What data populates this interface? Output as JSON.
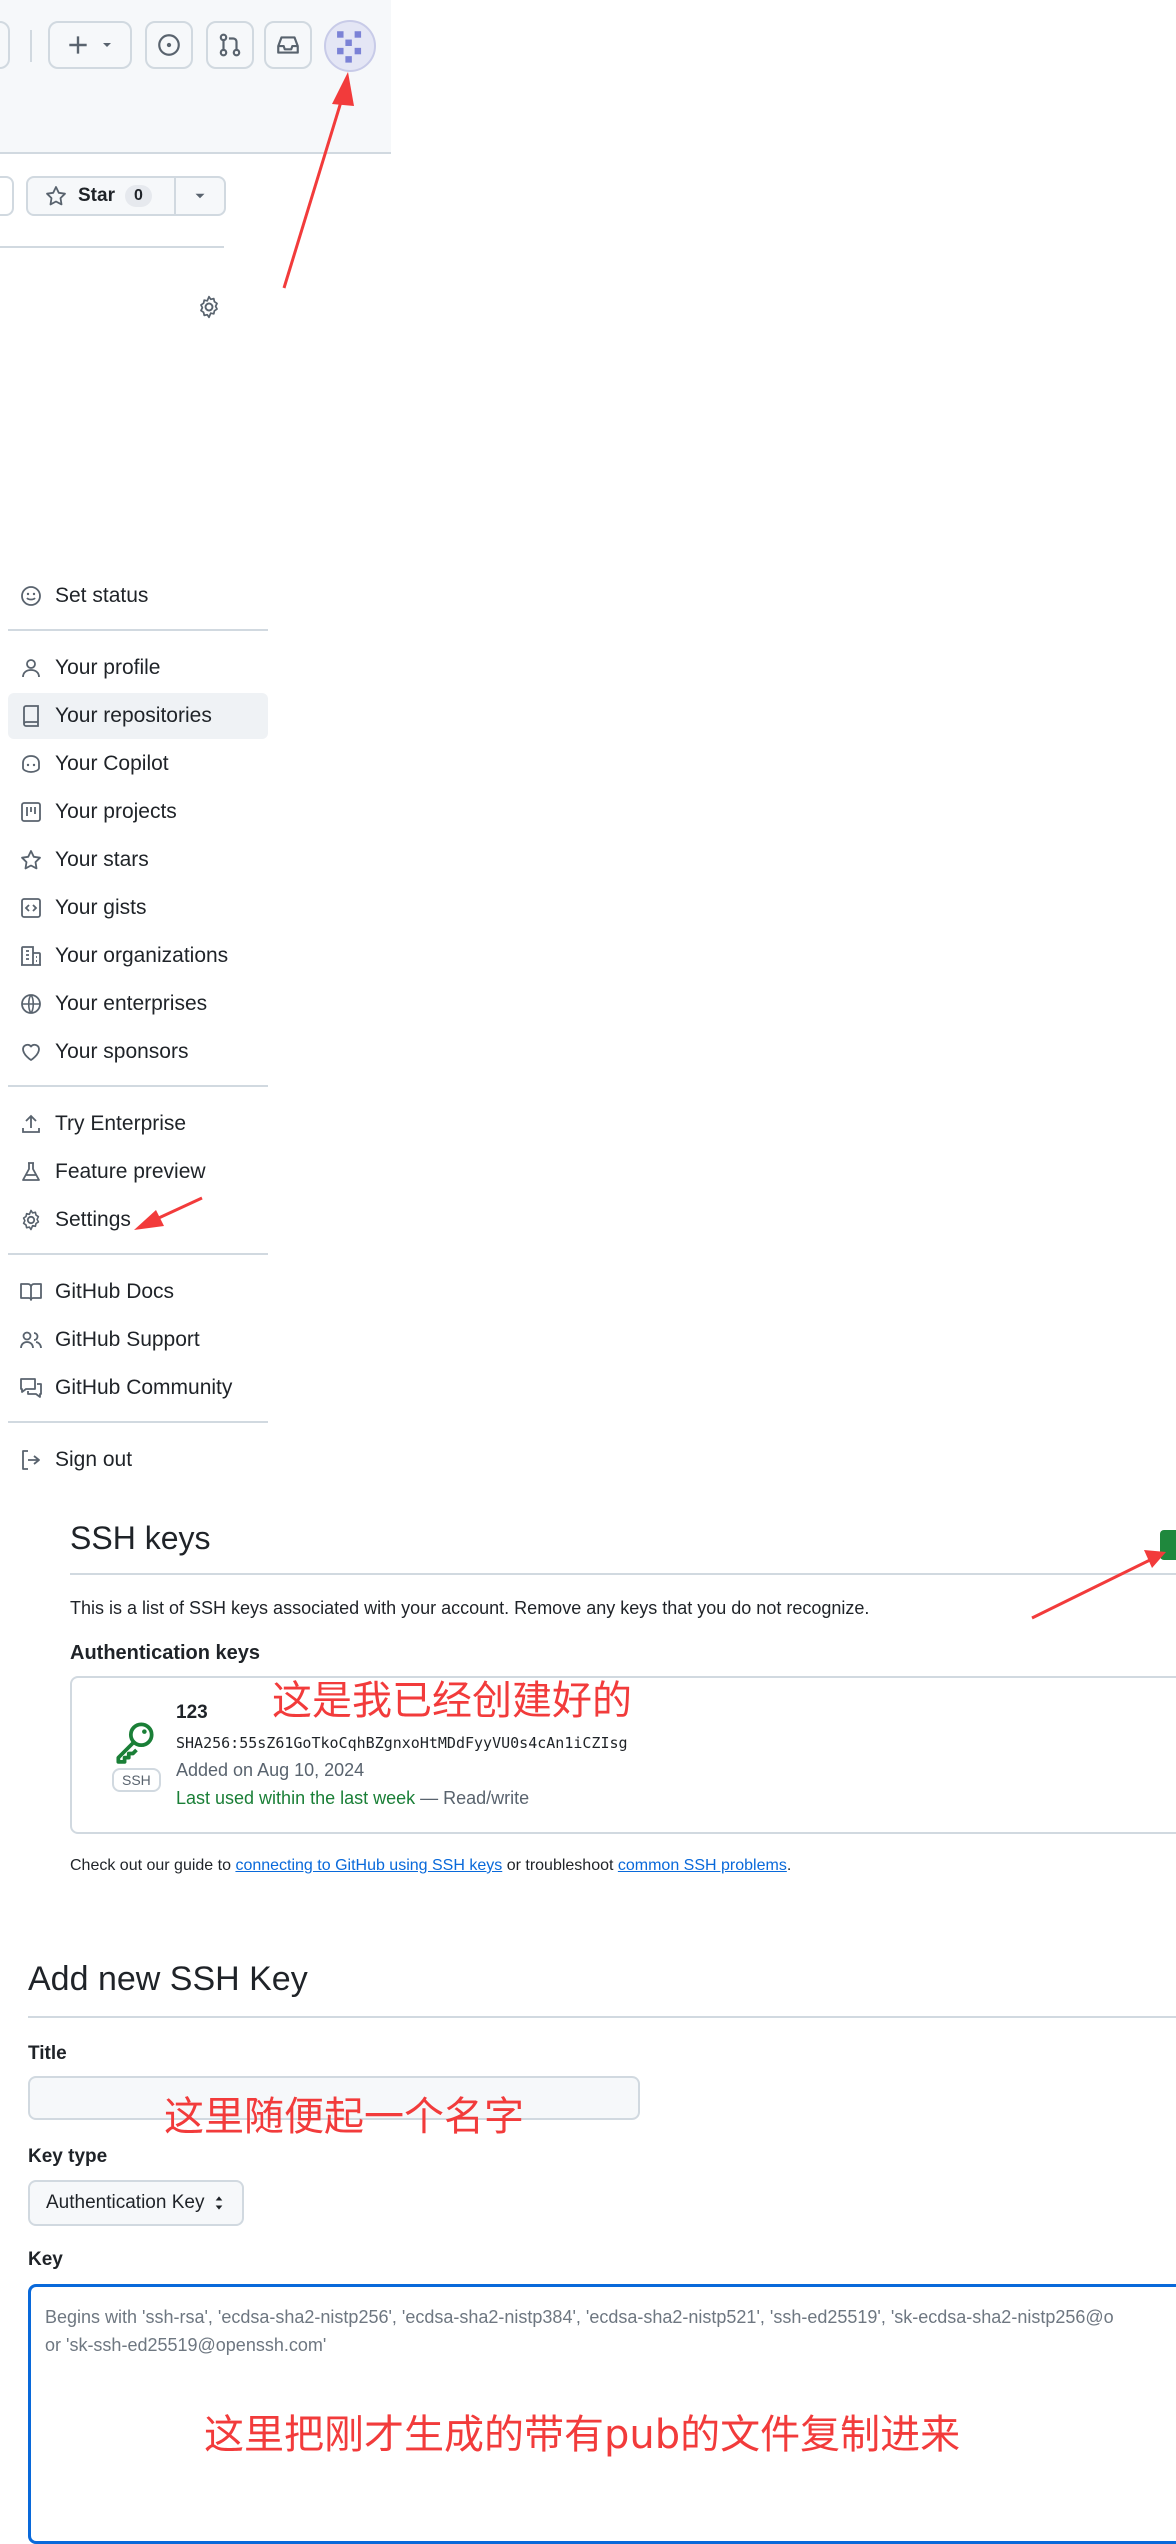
{
  "header": {
    "buttons": [
      {
        "name": "create-new-button",
        "icon": "plus-icon"
      },
      {
        "name": "issues-button",
        "icon": "issue-opened-icon"
      },
      {
        "name": "pull-requests-button",
        "icon": "git-pull-request-icon"
      },
      {
        "name": "inbox-button",
        "icon": "inbox-icon"
      }
    ],
    "avatar": "identicon"
  },
  "repo": {
    "star_label": "Star",
    "star_count": "0"
  },
  "menu": {
    "items": [
      {
        "label": "Set status",
        "icon": "smiley-icon"
      },
      {
        "label": "Your profile",
        "icon": "person-icon"
      },
      {
        "label": "Your repositories",
        "icon": "repo-icon"
      },
      {
        "label": "Your Copilot",
        "icon": "copilot-icon"
      },
      {
        "label": "Your projects",
        "icon": "project-icon"
      },
      {
        "label": "Your stars",
        "icon": "star-icon"
      },
      {
        "label": "Your gists",
        "icon": "code-square-icon"
      },
      {
        "label": "Your organizations",
        "icon": "organization-icon"
      },
      {
        "label": "Your enterprises",
        "icon": "globe-icon"
      },
      {
        "label": "Your sponsors",
        "icon": "heart-icon"
      },
      {
        "label": "Try Enterprise",
        "icon": "upload-icon"
      },
      {
        "label": "Feature preview",
        "icon": "beaker-icon"
      },
      {
        "label": "Settings",
        "icon": "gear-icon"
      },
      {
        "label": "GitHub Docs",
        "icon": "book-icon"
      },
      {
        "label": "GitHub Support",
        "icon": "people-icon"
      },
      {
        "label": "GitHub Community",
        "icon": "comment-discussion-icon"
      },
      {
        "label": "Sign out",
        "icon": "sign-out-icon"
      }
    ]
  },
  "ssh": {
    "title": "SSH keys",
    "description": "This is a list of SSH keys associated with your account. Remove any keys that you do not recognize.",
    "auth_title": "Authentication keys",
    "key": {
      "name": "123",
      "fingerprint": "SHA256:55sZ61GoTkoCqhBZgnxoHtMDdFyyVU0s4cAn1iCZIsg",
      "added": "Added on Aug 10, 2024",
      "last_used": "Last used within the last week",
      "access": " — Read/write",
      "badge": "SSH"
    },
    "guide": {
      "prefix": "Check out our guide to ",
      "link1": "connecting to GitHub using SSH keys",
      "middle": " or troubleshoot ",
      "link2": "common SSH problems",
      "suffix": "."
    }
  },
  "add_key": {
    "title": "Add new SSH Key",
    "title_label": "Title",
    "key_type_label": "Key type",
    "key_type_value": "Authentication Key",
    "key_label": "Key",
    "key_placeholder": "Begins with 'ssh-rsa', 'ecdsa-sha2-nistp256', 'ecdsa-sha2-nistp384', 'ecdsa-sha2-nistp521', 'ssh-ed25519', 'sk-ecdsa-sha2-nistp256@o\nor 'sk-ssh-ed25519@openssh.com'"
  },
  "annotations": {
    "created_note": "这是我已经创建好的",
    "title_note": "这里随便起一个名字",
    "key_note": "这里把刚才生成的带有pub的文件复制进来",
    "accent_color": "#f23b3b"
  }
}
